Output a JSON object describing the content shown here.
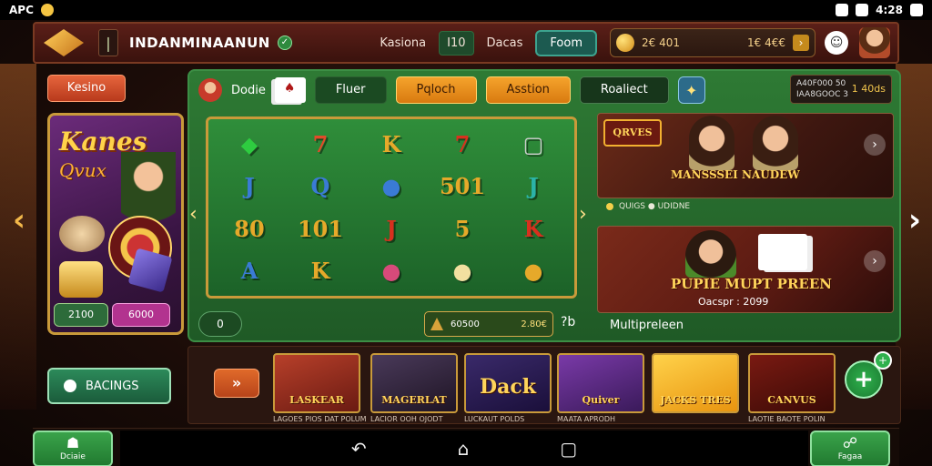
{
  "status_bar": {
    "app_label": "APC",
    "time": "4:28"
  },
  "header": {
    "title": "INDANMINAANUN",
    "tabs": [
      "Kasiona",
      "I10",
      "Dacas"
    ],
    "active_tab": "Foom",
    "coin_value": "2€ 401",
    "coin_value_secondary": "1€ 4€€"
  },
  "left": {
    "kesino_label": "Kesino",
    "promo_title": "Kanes",
    "promo_subtitle": "Qvux",
    "promo_btn1": "2100",
    "promo_btn2": "6000",
    "bacings_label": "BACINGS"
  },
  "main": {
    "tab_label": "Dodie",
    "tabs": [
      "Fluer",
      "Pqloch",
      "Asstion",
      "Roaliect"
    ],
    "info_lines": [
      "A40F000 50",
      "IAA8GOOC 3"
    ],
    "info_value": "1 40ds",
    "reel_symbols": [
      "◆",
      "7",
      "K",
      "7",
      "▢",
      "J",
      "Q",
      "●",
      "501",
      "J",
      "80",
      "101",
      "J",
      "5",
      "K",
      "A",
      "K",
      "●",
      "●",
      "●"
    ],
    "spin_label": "0",
    "bet_value": "60500",
    "bet_value2": "2.80€",
    "help_label": "?b",
    "feature1": {
      "badge": "QRVES",
      "title": "MANSSSEI  NAUDEW",
      "meta": "QUIGS  ● UDIDNE"
    },
    "feature2": {
      "title": "PUPIE MUPT PREEN",
      "subtitle": "Oacspr : 2099"
    },
    "multiplayer_label": "Multipreleen"
  },
  "games": [
    {
      "name": "LASKEAR",
      "caption": "LAGOES PIOS DAT POLUM"
    },
    {
      "name": "MAGERLAT",
      "caption": "LACIOR OOH OJODT"
    },
    {
      "name": "Dack",
      "caption": "LUCKAUT POLDS"
    },
    {
      "name": "Quiver",
      "caption": "MAATA APRODH"
    },
    {
      "name": "JACKS TRES",
      "caption": ""
    },
    {
      "name": "CANVUS",
      "caption": "LAOTIE BAOTE POLIN"
    }
  ],
  "bottom": {
    "left_label": "Dciaie",
    "right_label": "Fagaa"
  }
}
